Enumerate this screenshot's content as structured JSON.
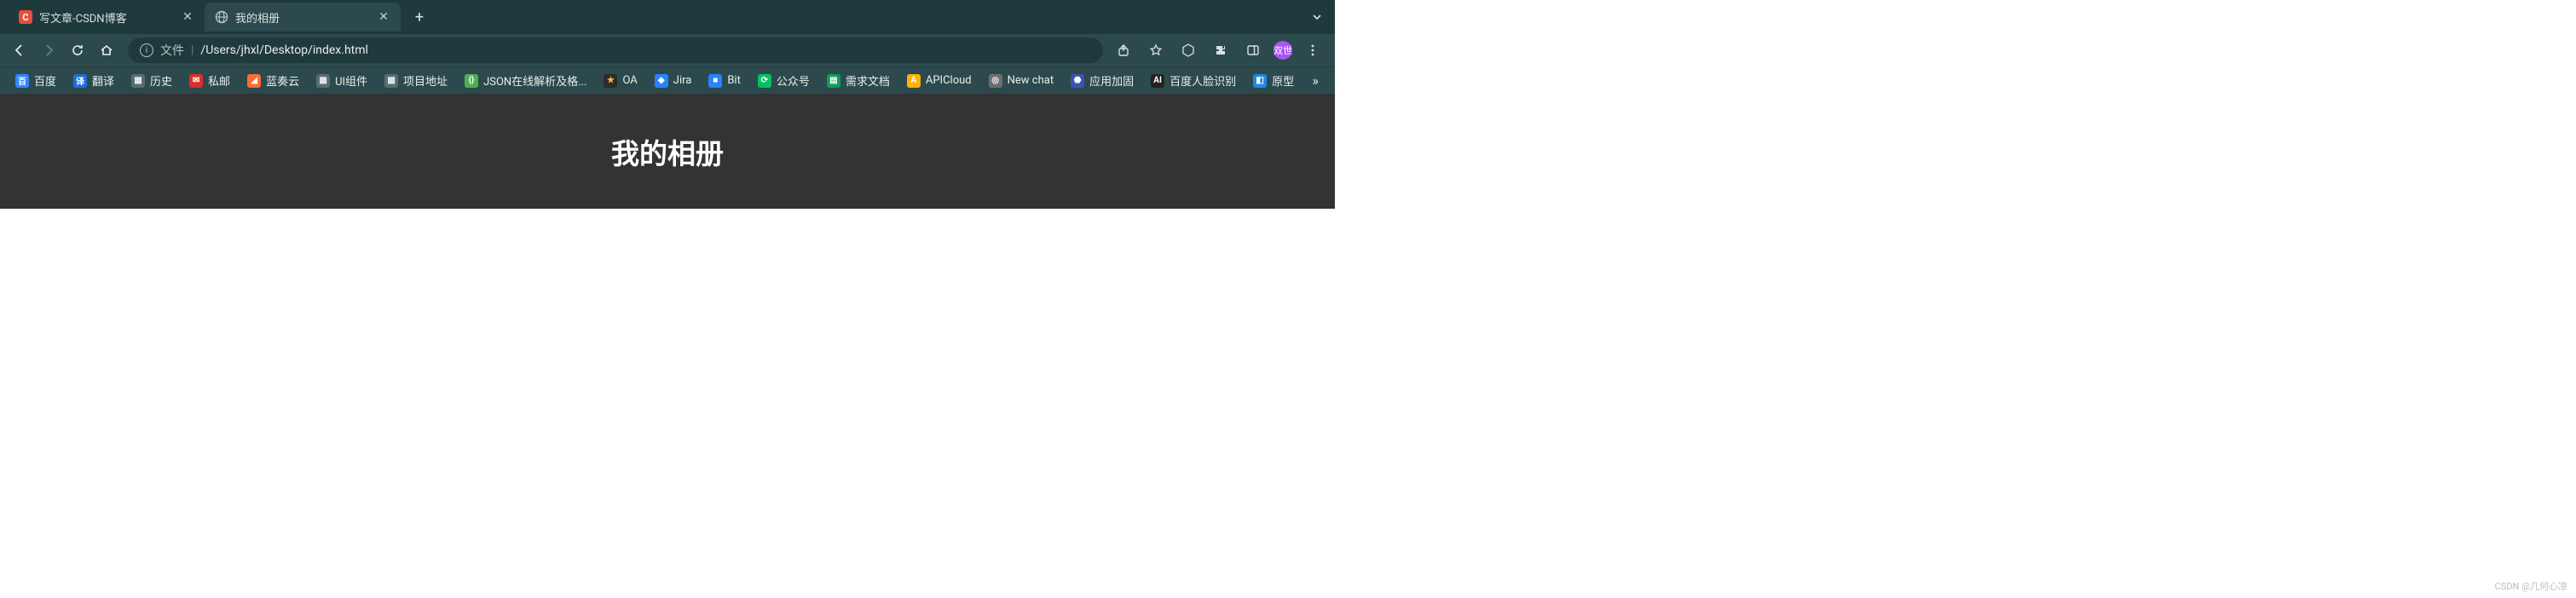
{
  "tabs": [
    {
      "title": "写文章-CSDN博客",
      "favicon_bg": "#e74c3c",
      "favicon_text": "C",
      "favicon_fg": "#fff",
      "active": false
    },
    {
      "title": "我的相册",
      "favicon_bg": "transparent",
      "favicon_text": "",
      "favicon_fg": "#b8c4c4",
      "active": true
    }
  ],
  "omnibox": {
    "scheme_label": "文件",
    "path": "/Users/jhxl/Desktop/index.html"
  },
  "bookmarks": [
    {
      "label": "百度",
      "icon_bg": "#3385ff",
      "icon_fg": "#fff",
      "icon_text": "百"
    },
    {
      "label": "翻译",
      "icon_bg": "#1e6fd9",
      "icon_fg": "#fff",
      "icon_text": "译"
    },
    {
      "label": "历史",
      "icon_bg": "#5a6b6d",
      "icon_fg": "#e8eeee",
      "icon_text": "▦"
    },
    {
      "label": "私邮",
      "icon_bg": "#d93025",
      "icon_fg": "#fff",
      "icon_text": "✉"
    },
    {
      "label": "蓝奏云",
      "icon_bg": "#ff6b35",
      "icon_fg": "#fff",
      "icon_text": "◢"
    },
    {
      "label": "UI组件",
      "icon_bg": "#5a6b6d",
      "icon_fg": "#e8eeee",
      "icon_text": "▦"
    },
    {
      "label": "项目地址",
      "icon_bg": "#5a6b6d",
      "icon_fg": "#e8eeee",
      "icon_text": "▦"
    },
    {
      "label": "JSON在线解析及格...",
      "icon_bg": "#4caf50",
      "icon_fg": "#fff",
      "icon_text": "{}"
    },
    {
      "label": "OA",
      "icon_bg": "#2b2b2b",
      "icon_fg": "#fbc02d",
      "icon_text": "★"
    },
    {
      "label": "Jira",
      "icon_bg": "#2684ff",
      "icon_fg": "#fff",
      "icon_text": "◆"
    },
    {
      "label": "Bit",
      "icon_bg": "#2684ff",
      "icon_fg": "#fff",
      "icon_text": "■"
    },
    {
      "label": "公众号",
      "icon_bg": "#07c160",
      "icon_fg": "#fff",
      "icon_text": "⟳"
    },
    {
      "label": "需求文档",
      "icon_bg": "#0f9d58",
      "icon_fg": "#fff",
      "icon_text": "▤"
    },
    {
      "label": "APICloud",
      "icon_bg": "#ffb300",
      "icon_fg": "#fff",
      "icon_text": "A"
    },
    {
      "label": "New chat",
      "icon_bg": "#6e6e6e",
      "icon_fg": "#fff",
      "icon_text": "◎"
    },
    {
      "label": "应用加固",
      "icon_bg": "#3f51b5",
      "icon_fg": "#fff",
      "icon_text": "⬣"
    },
    {
      "label": "百度人脸识别",
      "icon_bg": "#222",
      "icon_fg": "#fff",
      "icon_text": "AI"
    },
    {
      "label": "原型",
      "icon_bg": "#1e88e5",
      "icon_fg": "#fff",
      "icon_text": "◧"
    }
  ],
  "toolbar_right": {
    "avatar_text": "双世"
  },
  "page": {
    "heading": "我的相册"
  },
  "watermark": "CSDN @几何心凉"
}
